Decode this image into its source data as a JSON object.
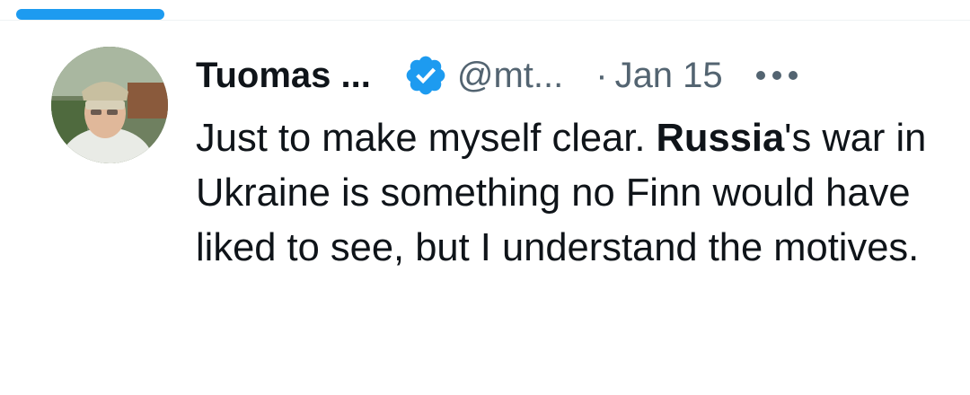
{
  "tweet": {
    "author": {
      "display_name": "Tuomas ...",
      "handle": "@mt...",
      "verified_icon": "verified-badge-icon",
      "avatar_icon": "avatar-photo"
    },
    "separator": "·",
    "date": "Jan 15",
    "more_icon": "more-horizontal-icon",
    "text": {
      "part1": "Just to make myself clear. ",
      "bold": "Russia",
      "part2": "'s war in Ukraine is something no Finn would have liked to see, but I understand the motives."
    }
  },
  "colors": {
    "accent": "#1d9bf0",
    "text_primary": "#0f1419",
    "text_secondary": "#536471"
  }
}
